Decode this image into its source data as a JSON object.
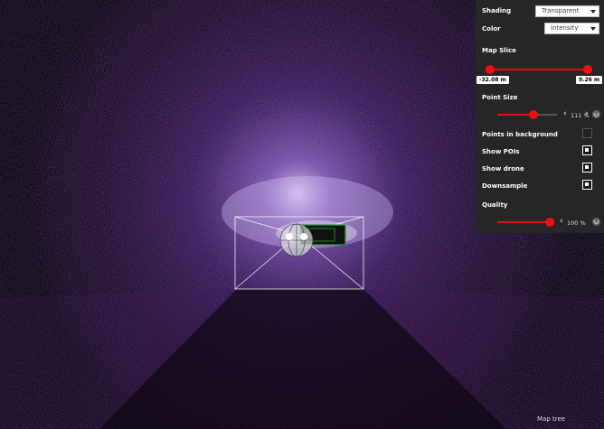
{
  "panel": {
    "shading": {
      "label": "Shading",
      "value": "Transparent"
    },
    "color": {
      "label": "Color",
      "value": "Intensity"
    },
    "map_slice": {
      "label": "Map Slice",
      "min_label": "-32.08 m",
      "max_label": "9.26 m"
    },
    "point_size": {
      "label": "Point Size",
      "value_label": "111 %",
      "level": 0.6
    },
    "points_in_background": {
      "label": "Points in background",
      "checked": false
    },
    "show_pois": {
      "label": "Show POIs",
      "checked": true
    },
    "show_drone": {
      "label": "Show drone",
      "checked": true
    },
    "downsample": {
      "label": "Downsample",
      "checked": true
    },
    "quality": {
      "label": "Quality",
      "value_label": "100 %",
      "level": 1.0
    }
  },
  "footer": {
    "map_tree_label": "Map tree"
  },
  "colors": {
    "accent": "#e01010",
    "panel_bg": "#262627",
    "points": "#8a3ad0"
  },
  "icons": {
    "reset": "reset-icon",
    "chevron_left": "chevron-left-icon",
    "chevron_right": "chevron-right-icon"
  }
}
